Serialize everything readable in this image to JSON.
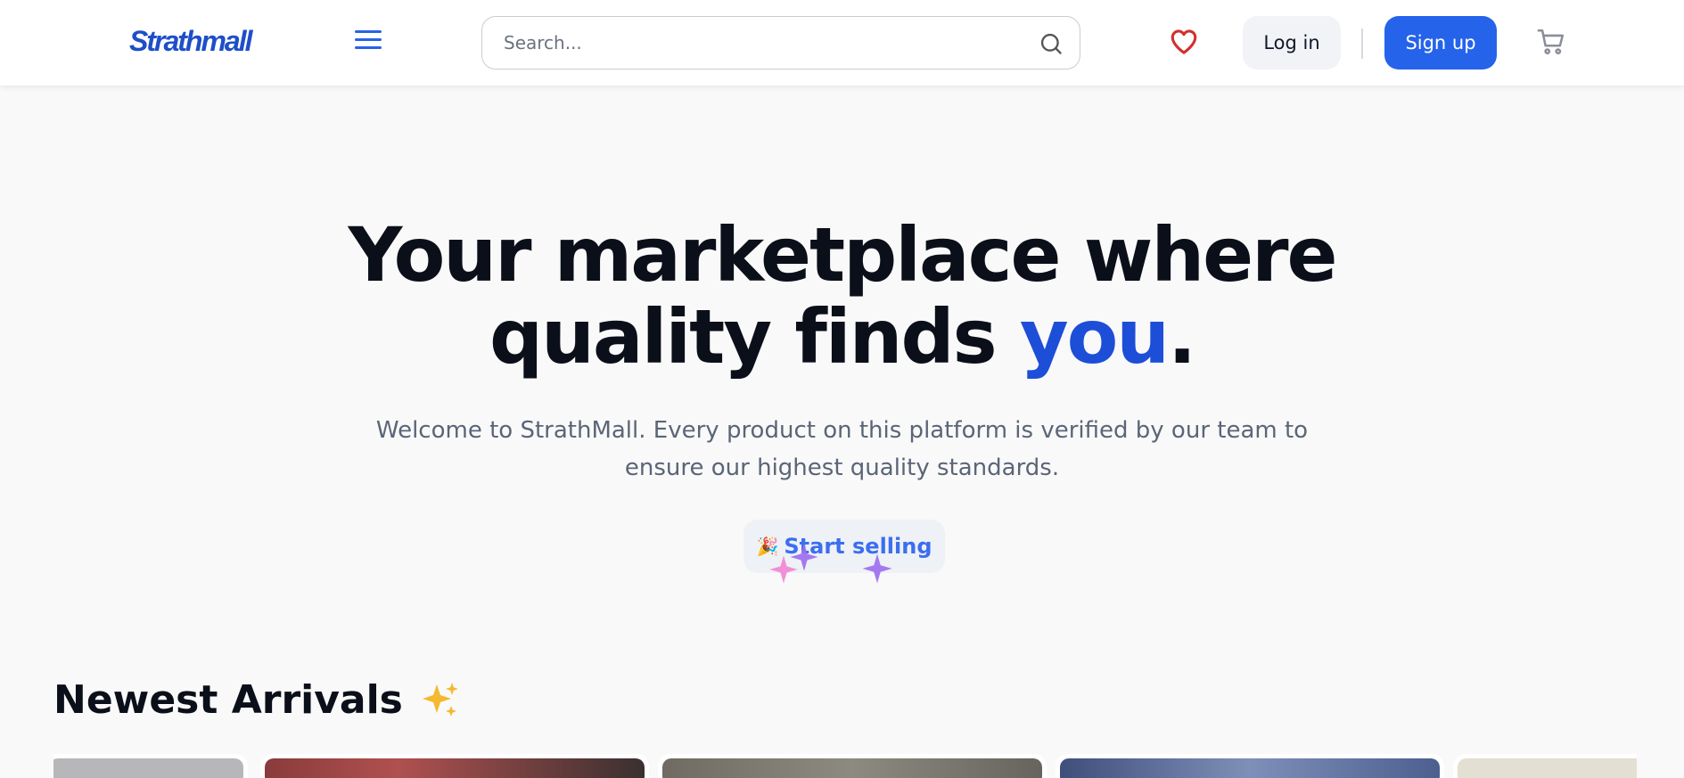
{
  "header": {
    "logo_text": "Strathmall",
    "search_placeholder": "Search...",
    "login_label": "Log in",
    "signup_label": "Sign up",
    "icons": [
      "menu-icon",
      "search-icon",
      "heart-icon",
      "cart-icon"
    ],
    "colors": {
      "brand": "#1e4fc9",
      "primary": "#2563eb",
      "heart": "#d32f2f"
    }
  },
  "hero": {
    "title_line1": "Your marketplace where",
    "title_line2_prefix": "quality finds ",
    "title_accent": "you",
    "title_suffix": ".",
    "subtitle": "Welcome to StrathMall. Every product on this platform is verified by our team to ensure our highest quality standards.",
    "cta_label": "Start selling",
    "cta_emoji": "🎉"
  },
  "newest": {
    "title": "Newest Arrivals",
    "emoji": "✨",
    "cards": [
      {
        "name": "product-card-1",
        "color": "#b7b7b9"
      },
      {
        "name": "product-card-2",
        "color": "#8a3b3b"
      },
      {
        "name": "product-card-3",
        "color": "#7d7a72"
      },
      {
        "name": "product-card-4",
        "color": "#4c5f8f"
      },
      {
        "name": "product-card-5",
        "color": "#e3dfd2"
      }
    ]
  }
}
